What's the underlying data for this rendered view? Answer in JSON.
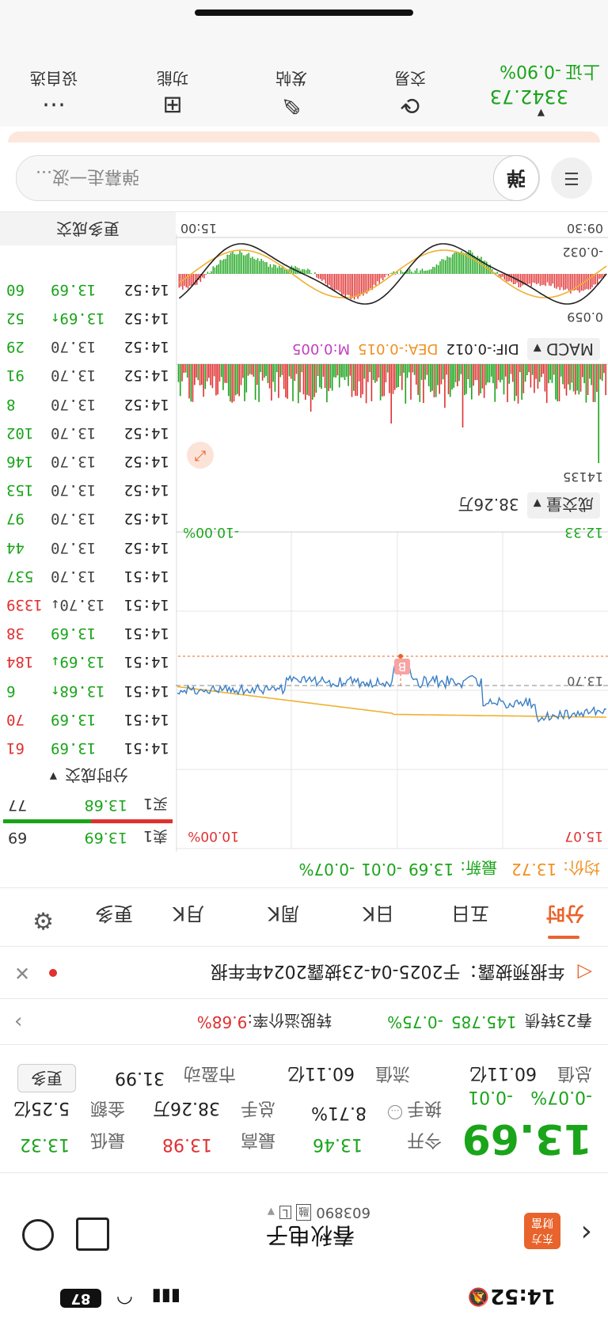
{
  "status_bar": {
    "time": "14:52",
    "battery": "87"
  },
  "header": {
    "stock_name": "春秋电子",
    "stock_code": "603890",
    "badge_rong": "融",
    "badge_l": "L"
  },
  "quote": {
    "price": "13.69",
    "change": "-0.01",
    "change_pct": "-0.07%",
    "open_label": "今开",
    "open": "13.46",
    "high_label": "最高",
    "high": "13.98",
    "low_label": "最低",
    "low": "13.32",
    "turnover_label": "换手",
    "turnover": "8.71%",
    "volume_label": "总手",
    "volume": "38.26万",
    "amount_label": "金额",
    "amount": "5.25亿",
    "mktcap_label": "总值",
    "mktcap": "60.11亿",
    "float_label": "流值",
    "float": "60.11亿",
    "pe_label": "市盈动",
    "pe": "31.99",
    "more_btn": "更多"
  },
  "convertible": {
    "name": "春23转债",
    "price": "145.785",
    "change_pct": "-0.75%",
    "premium_label": "转股溢价率:",
    "premium": "9.68%"
  },
  "notice": {
    "text": "年报预披露：于2025-04-23披露2024年年报"
  },
  "tabs": {
    "items": [
      "分时",
      "五日",
      "日K",
      "周K",
      "月K",
      "更多"
    ]
  },
  "chart_header": {
    "avg_label": "均价:",
    "avg": "13.72",
    "latest_label": "最新:",
    "latest": "13.69",
    "change": "-0.01",
    "change_pct": "-0.07%"
  },
  "chart_labels": {
    "top_left_price": "15.07",
    "top_right_pct": "10.00%",
    "bottom_left_price": "12.33",
    "bottom_right_pct": "-10.00%",
    "ref_price": "13.70",
    "b_marker": "B",
    "volume_indicator": "成交量",
    "volume_value": "38.26万",
    "vol_max": "14135",
    "macd_indicator": "MACD",
    "dif": "DIF:-0.012",
    "dea": "DEA:-0.015",
    "m": "M:0.005",
    "macd_top": "0.059",
    "macd_bottom": "-0.032",
    "time_start": "09:30",
    "time_end": "15:00"
  },
  "order_book": {
    "sell1_label": "卖1",
    "sell1_price": "13.69",
    "sell1_vol": "69",
    "buy1_label": "买1",
    "buy1_price": "13.68",
    "buy1_vol": "77"
  },
  "trades": {
    "header": "分时成交",
    "more": "更多成交",
    "rows": [
      {
        "time": "14:51",
        "price": "13.69",
        "vol": "61",
        "pc": "green",
        "vc": "red"
      },
      {
        "time": "14:51",
        "price": "13.69",
        "vol": "70",
        "pc": "green",
        "vc": "red"
      },
      {
        "time": "14:51",
        "price": "13.68↑",
        "vol": "6",
        "pc": "green",
        "vc": "green"
      },
      {
        "time": "14:51",
        "price": "13.69↓",
        "vol": "184",
        "pc": "green",
        "vc": "red"
      },
      {
        "time": "14:51",
        "price": "13.69",
        "vol": "38",
        "pc": "green",
        "vc": "red"
      },
      {
        "time": "14:51",
        "price": "13.70↓",
        "vol": "1339",
        "pc": "grey",
        "vc": "red"
      },
      {
        "time": "14:51",
        "price": "13.70",
        "vol": "537",
        "pc": "grey",
        "vc": "green"
      },
      {
        "time": "14:52",
        "price": "13.70",
        "vol": "44",
        "pc": "grey",
        "vc": "green"
      },
      {
        "time": "14:52",
        "price": "13.70",
        "vol": "97",
        "pc": "grey",
        "vc": "green"
      },
      {
        "time": "14:52",
        "price": "13.70",
        "vol": "153",
        "pc": "grey",
        "vc": "green"
      },
      {
        "time": "14:52",
        "price": "13.70",
        "vol": "146",
        "pc": "grey",
        "vc": "green"
      },
      {
        "time": "14:52",
        "price": "13.70",
        "vol": "102",
        "pc": "grey",
        "vc": "green"
      },
      {
        "time": "14:52",
        "price": "13.70",
        "vol": "8",
        "pc": "grey",
        "vc": "green"
      },
      {
        "time": "14:52",
        "price": "13.70",
        "vol": "91",
        "pc": "grey",
        "vc": "green"
      },
      {
        "time": "14:52",
        "price": "13.70",
        "vol": "29",
        "pc": "grey",
        "vc": "green"
      },
      {
        "time": "14:52",
        "price": "13.69↑",
        "vol": "52",
        "pc": "green",
        "vc": "green"
      },
      {
        "time": "14:52",
        "price": "13.69",
        "vol": "60",
        "pc": "green",
        "vc": "green"
      }
    ]
  },
  "comment": {
    "placeholder": "弹幕走一波...",
    "danmu_btn": "弹"
  },
  "bottom_nav": {
    "index_name": "上证",
    "index_pct": "-0.90%",
    "index_value": "3342.73",
    "trade": "交易",
    "post": "发帖",
    "func": "功能",
    "watchlist": "设自选"
  },
  "colors": {
    "red": "#e03030",
    "green": "#1aa41a",
    "orange": "#f09020",
    "blue": "#3a7fc6",
    "accent": "#e8642c"
  }
}
